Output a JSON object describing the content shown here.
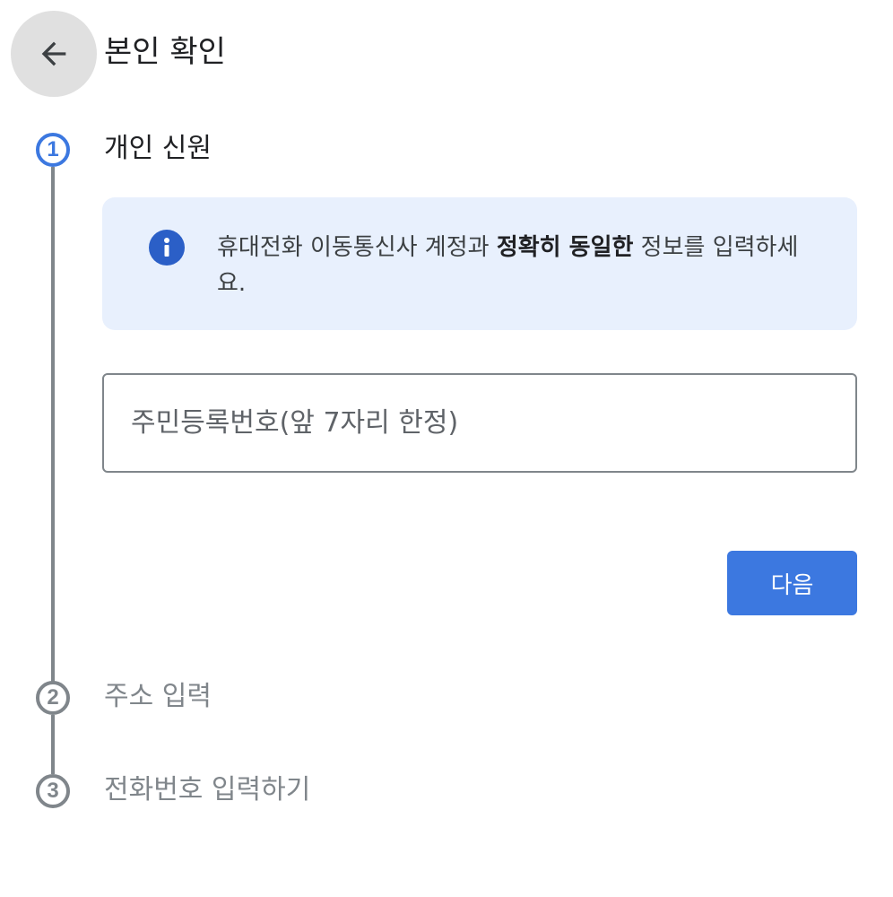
{
  "header": {
    "title": "본인 확인",
    "back_icon": "arrow-left-icon"
  },
  "steps": [
    {
      "number": "1",
      "label": "개인 신원",
      "state": "active"
    },
    {
      "number": "2",
      "label": "주소 입력",
      "state": "inactive"
    },
    {
      "number": "3",
      "label": "전화번호 입력하기",
      "state": "inactive"
    }
  ],
  "notice": {
    "icon": "info-icon",
    "text_before": "휴대전화 이동통신사 계정과 ",
    "text_bold": "정확히 동일한",
    "text_after": " 정보를 입력하세요."
  },
  "id_field": {
    "placeholder": "주민등록번호(앞 7자리 한정)",
    "value": ""
  },
  "next_button": {
    "label": "다음"
  },
  "colors": {
    "accent": "#3c78e0",
    "notice_bg": "#e8f0fd",
    "inactive": "#80868b",
    "info_icon": "#2b5fc7"
  }
}
